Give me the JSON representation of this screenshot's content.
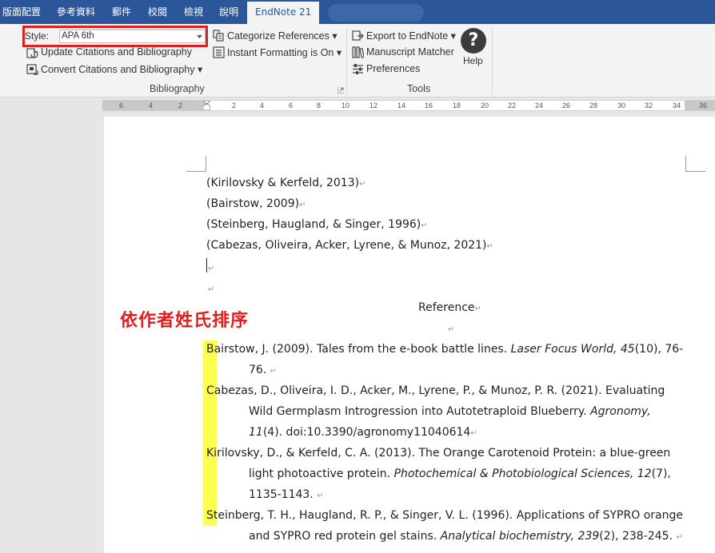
{
  "tabs": {
    "layout": "版面配置",
    "references": "參考資料",
    "mailings": "郵件",
    "review": "校閱",
    "view": "檢視",
    "help": "說明",
    "endnote": "EndNote 21"
  },
  "ribbon": {
    "style_label": "Style:",
    "style_value": "APA 6th",
    "update_citations": "Update Citations and Bibliography",
    "convert_citations": "Convert Citations and Bibliography",
    "categorize_references": "Categorize References",
    "instant_formatting": "Instant Formatting is On",
    "export_to_endnote": "Export to EndNote",
    "manuscript_matcher": "Manuscript Matcher",
    "preferences": "Preferences",
    "help": "Help",
    "group_bibliography": "Bibliography",
    "group_tools": "Tools"
  },
  "ruler": {
    "numbers_left": [
      "6",
      "4",
      "2"
    ],
    "numbers_right": [
      "2",
      "4",
      "6",
      "8",
      "10",
      "12",
      "14",
      "16",
      "18",
      "20",
      "22",
      "24",
      "26",
      "28",
      "30",
      "32",
      "34",
      "36"
    ]
  },
  "document": {
    "citations": [
      "(Kirilovsky & Kerfeld, 2013)",
      "(Bairstow, 2009)",
      "(Steinberg, Haugland, & Singer, 1996)",
      "(Cabezas, Oliveira, Acker, Lyrene, & Munoz, 2021)"
    ],
    "heading": "Reference",
    "annotation": "依作者姓氏排序",
    "paragraph_mark": "↵",
    "references": [
      {
        "line1_plain": "Bairstow, J. (2009). Tales from the e-book battle lines. ",
        "line1_italic": "Laser Focus World, 45",
        "line1_tail": "(10), 76-",
        "line2_plain": "76. ",
        "line2_italic": "",
        "line2_tail": "",
        "line3_plain": "",
        "line3_italic": "",
        "line3_tail": ""
      },
      {
        "line1_plain": "Cabezas, D., Oliveira, I. D., Acker, M., Lyrene, P., & Munoz, P. R. (2021). Evaluating",
        "line1_italic": "",
        "line1_tail": "",
        "line2_plain": "Wild Germplasm Introgression into Autotetraploid Blueberry. ",
        "line2_italic": "Agronomy,",
        "line2_tail": "",
        "line3_plain": "",
        "line3_italic": "11",
        "line3_tail": "(4). doi:10.3390/agronomy11040614"
      },
      {
        "line1_plain": "Kirilovsky, D., & Kerfeld, C. A. (2013). The Orange Carotenoid Protein: a blue-green",
        "line1_italic": "",
        "line1_tail": "",
        "line2_plain": "light photoactive protein. ",
        "line2_italic": "Photochemical & Photobiological Sciences, 12",
        "line2_tail": "(7),",
        "line3_plain": "1135-1143. ",
        "line3_italic": "",
        "line3_tail": ""
      },
      {
        "line1_plain": "Steinberg, T. H., Haugland, R. P., & Singer, V. L. (1996). Applications of SYPRO orange",
        "line1_italic": "",
        "line1_tail": "",
        "line2_plain": "and SYPRO red protein gel stains. ",
        "line2_italic": "Analytical biochemistry, 239",
        "line2_tail": "(2), 238-245. ",
        "line3_plain": "",
        "line3_italic": "",
        "line3_tail": ""
      }
    ]
  },
  "colors": {
    "tabbar": "#2b579a",
    "ribbon": "#f3f3f3",
    "highlight": "#fbff4f",
    "annotation": "#e31c1c",
    "style_box_border": "#e02020"
  },
  "icons": [
    "update-citations-icon",
    "convert-citations-icon",
    "categorize-references-icon",
    "instant-formatting-icon",
    "export-to-endnote-icon",
    "manuscript-matcher-icon",
    "preferences-icon",
    "help-icon",
    "dropdown-arrow-icon",
    "dialog-launcher-icon"
  ]
}
